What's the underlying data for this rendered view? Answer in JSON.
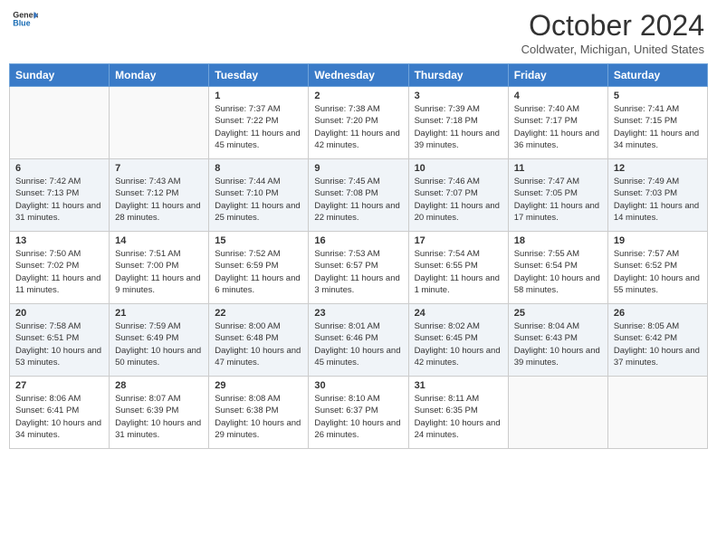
{
  "header": {
    "logo_line1": "General",
    "logo_line2": "Blue",
    "month_title": "October 2024",
    "location": "Coldwater, Michigan, United States"
  },
  "weekdays": [
    "Sunday",
    "Monday",
    "Tuesday",
    "Wednesday",
    "Thursday",
    "Friday",
    "Saturday"
  ],
  "weeks": [
    [
      {
        "day": null
      },
      {
        "day": null
      },
      {
        "day": "1",
        "sunrise": "Sunrise: 7:37 AM",
        "sunset": "Sunset: 7:22 PM",
        "daylight": "Daylight: 11 hours and 45 minutes."
      },
      {
        "day": "2",
        "sunrise": "Sunrise: 7:38 AM",
        "sunset": "Sunset: 7:20 PM",
        "daylight": "Daylight: 11 hours and 42 minutes."
      },
      {
        "day": "3",
        "sunrise": "Sunrise: 7:39 AM",
        "sunset": "Sunset: 7:18 PM",
        "daylight": "Daylight: 11 hours and 39 minutes."
      },
      {
        "day": "4",
        "sunrise": "Sunrise: 7:40 AM",
        "sunset": "Sunset: 7:17 PM",
        "daylight": "Daylight: 11 hours and 36 minutes."
      },
      {
        "day": "5",
        "sunrise": "Sunrise: 7:41 AM",
        "sunset": "Sunset: 7:15 PM",
        "daylight": "Daylight: 11 hours and 34 minutes."
      }
    ],
    [
      {
        "day": "6",
        "sunrise": "Sunrise: 7:42 AM",
        "sunset": "Sunset: 7:13 PM",
        "daylight": "Daylight: 11 hours and 31 minutes."
      },
      {
        "day": "7",
        "sunrise": "Sunrise: 7:43 AM",
        "sunset": "Sunset: 7:12 PM",
        "daylight": "Daylight: 11 hours and 28 minutes."
      },
      {
        "day": "8",
        "sunrise": "Sunrise: 7:44 AM",
        "sunset": "Sunset: 7:10 PM",
        "daylight": "Daylight: 11 hours and 25 minutes."
      },
      {
        "day": "9",
        "sunrise": "Sunrise: 7:45 AM",
        "sunset": "Sunset: 7:08 PM",
        "daylight": "Daylight: 11 hours and 22 minutes."
      },
      {
        "day": "10",
        "sunrise": "Sunrise: 7:46 AM",
        "sunset": "Sunset: 7:07 PM",
        "daylight": "Daylight: 11 hours and 20 minutes."
      },
      {
        "day": "11",
        "sunrise": "Sunrise: 7:47 AM",
        "sunset": "Sunset: 7:05 PM",
        "daylight": "Daylight: 11 hours and 17 minutes."
      },
      {
        "day": "12",
        "sunrise": "Sunrise: 7:49 AM",
        "sunset": "Sunset: 7:03 PM",
        "daylight": "Daylight: 11 hours and 14 minutes."
      }
    ],
    [
      {
        "day": "13",
        "sunrise": "Sunrise: 7:50 AM",
        "sunset": "Sunset: 7:02 PM",
        "daylight": "Daylight: 11 hours and 11 minutes."
      },
      {
        "day": "14",
        "sunrise": "Sunrise: 7:51 AM",
        "sunset": "Sunset: 7:00 PM",
        "daylight": "Daylight: 11 hours and 9 minutes."
      },
      {
        "day": "15",
        "sunrise": "Sunrise: 7:52 AM",
        "sunset": "Sunset: 6:59 PM",
        "daylight": "Daylight: 11 hours and 6 minutes."
      },
      {
        "day": "16",
        "sunrise": "Sunrise: 7:53 AM",
        "sunset": "Sunset: 6:57 PM",
        "daylight": "Daylight: 11 hours and 3 minutes."
      },
      {
        "day": "17",
        "sunrise": "Sunrise: 7:54 AM",
        "sunset": "Sunset: 6:55 PM",
        "daylight": "Daylight: 11 hours and 1 minute."
      },
      {
        "day": "18",
        "sunrise": "Sunrise: 7:55 AM",
        "sunset": "Sunset: 6:54 PM",
        "daylight": "Daylight: 10 hours and 58 minutes."
      },
      {
        "day": "19",
        "sunrise": "Sunrise: 7:57 AM",
        "sunset": "Sunset: 6:52 PM",
        "daylight": "Daylight: 10 hours and 55 minutes."
      }
    ],
    [
      {
        "day": "20",
        "sunrise": "Sunrise: 7:58 AM",
        "sunset": "Sunset: 6:51 PM",
        "daylight": "Daylight: 10 hours and 53 minutes."
      },
      {
        "day": "21",
        "sunrise": "Sunrise: 7:59 AM",
        "sunset": "Sunset: 6:49 PM",
        "daylight": "Daylight: 10 hours and 50 minutes."
      },
      {
        "day": "22",
        "sunrise": "Sunrise: 8:00 AM",
        "sunset": "Sunset: 6:48 PM",
        "daylight": "Daylight: 10 hours and 47 minutes."
      },
      {
        "day": "23",
        "sunrise": "Sunrise: 8:01 AM",
        "sunset": "Sunset: 6:46 PM",
        "daylight": "Daylight: 10 hours and 45 minutes."
      },
      {
        "day": "24",
        "sunrise": "Sunrise: 8:02 AM",
        "sunset": "Sunset: 6:45 PM",
        "daylight": "Daylight: 10 hours and 42 minutes."
      },
      {
        "day": "25",
        "sunrise": "Sunrise: 8:04 AM",
        "sunset": "Sunset: 6:43 PM",
        "daylight": "Daylight: 10 hours and 39 minutes."
      },
      {
        "day": "26",
        "sunrise": "Sunrise: 8:05 AM",
        "sunset": "Sunset: 6:42 PM",
        "daylight": "Daylight: 10 hours and 37 minutes."
      }
    ],
    [
      {
        "day": "27",
        "sunrise": "Sunrise: 8:06 AM",
        "sunset": "Sunset: 6:41 PM",
        "daylight": "Daylight: 10 hours and 34 minutes."
      },
      {
        "day": "28",
        "sunrise": "Sunrise: 8:07 AM",
        "sunset": "Sunset: 6:39 PM",
        "daylight": "Daylight: 10 hours and 31 minutes."
      },
      {
        "day": "29",
        "sunrise": "Sunrise: 8:08 AM",
        "sunset": "Sunset: 6:38 PM",
        "daylight": "Daylight: 10 hours and 29 minutes."
      },
      {
        "day": "30",
        "sunrise": "Sunrise: 8:10 AM",
        "sunset": "Sunset: 6:37 PM",
        "daylight": "Daylight: 10 hours and 26 minutes."
      },
      {
        "day": "31",
        "sunrise": "Sunrise: 8:11 AM",
        "sunset": "Sunset: 6:35 PM",
        "daylight": "Daylight: 10 hours and 24 minutes."
      },
      {
        "day": null
      },
      {
        "day": null
      }
    ]
  ]
}
